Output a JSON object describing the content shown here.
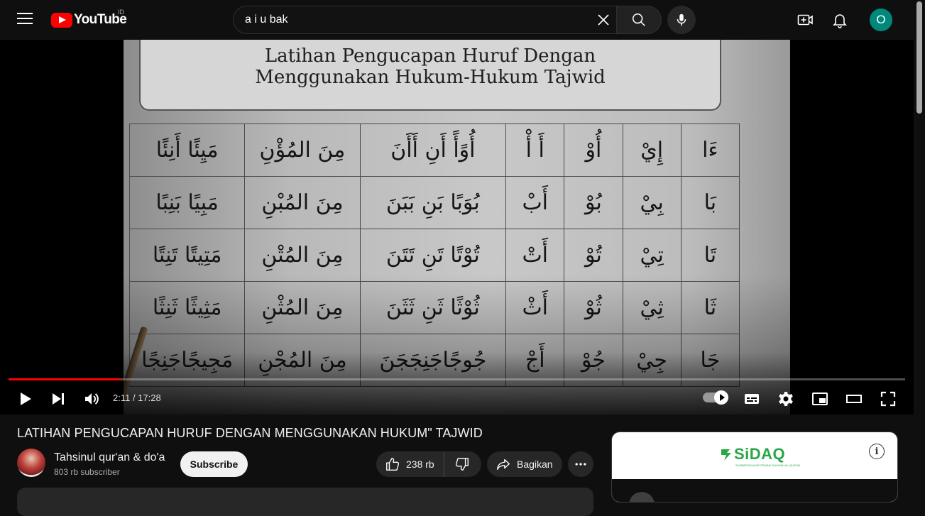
{
  "masthead": {
    "logo_text": "YouTube",
    "country_code": "ID",
    "search_value": "a i u bak",
    "avatar_letter": "O",
    "icons": [
      "menu-icon",
      "youtube-logo",
      "close-icon",
      "search-icon",
      "mic-icon",
      "create-icon",
      "bell-icon"
    ]
  },
  "video_frame": {
    "banner_line1": "Latihan Pengucapan Huruf Dengan",
    "banner_line2": "Menggunakan Hukum-Hukum Tajwid",
    "rows": [
      [
        "ءَا",
        "إِيْ",
        "أُوْ",
        "أَ أْ",
        "أُوًأً أَنِ أَأَنَ",
        "مِنَ المُؤْنِ",
        "مَيِئًا أَنِئًا"
      ],
      [
        "بَا",
        "بِيْ",
        "بُوْ",
        "أَبْ",
        "بُوَبًا بَنِ بَبَنَ",
        "مِنَ المُبْنِ",
        "مَبِيًا بَنِبًا"
      ],
      [
        "تَا",
        "تِيْ",
        "تُوْ",
        "أَتْ",
        "تُوْتًا تَنِ تَتَنَ",
        "مِنَ المُتْنِ",
        "مَتِيتًا تَنِتًا"
      ],
      [
        "ثَا",
        "ثِيْ",
        "ثُوْ",
        "أَثْ",
        "ثُوْثًا ثَنِ ثَثَنَ",
        "مِنَ المُثْنِ",
        "مَثِيثًا ثَنِثًا"
      ],
      [
        "جَا",
        "جِيْ",
        "جُوْ",
        "أَجْ",
        "جُوجًاجَنِجَجَنَ",
        "مِنَ المُجْنِ",
        "مَجِيجًاجَنِجًا"
      ]
    ]
  },
  "player": {
    "time_current": "2:11",
    "time_total": "17:28",
    "time_display": "2:11 / 17:28",
    "progress_fraction": 0.125,
    "progress_color": "#ff0000"
  },
  "video": {
    "title": "LATIHAN PENGUCAPAN HURUF DENGAN MENGGUNAKAN HUKUM\" TAJWID",
    "channel_name": "Tahsinul qur'an & do'a",
    "subscribers": "803 rb subscriber",
    "subscribe_label": "Subscribe",
    "likes": "238 rb",
    "share_label": "Bagikan"
  },
  "ad": {
    "brand": "SiDAQ",
    "tagline": "SUMBERDAYA INFORMASI DAKWAH AL-QUR'AN",
    "brand_color": "#28a745"
  }
}
